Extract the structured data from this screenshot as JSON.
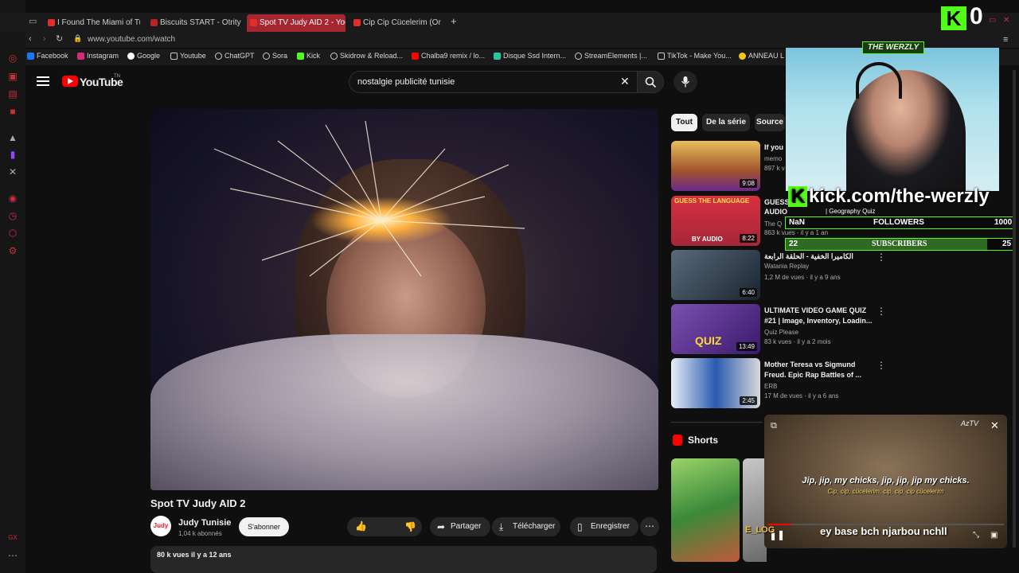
{
  "browser": {
    "tabs": [
      {
        "label": "I Found The Miami of Tun",
        "active": false
      },
      {
        "label": "Biscuits START - Otrity",
        "active": false
      },
      {
        "label": "Spot TV Judy AID 2 - You",
        "active": true
      },
      {
        "label": "Cip Cip Cücelerim (Or",
        "active": false
      }
    ],
    "new_tab": "+",
    "url": "www.youtube.com/watch",
    "bookmarks": [
      {
        "label": "Facebook",
        "color": "#1877f2"
      },
      {
        "label": "Instagram",
        "color": "#d62976"
      },
      {
        "label": "Google",
        "color": "#ffffff"
      },
      {
        "label": "Youtube",
        "color": "#cccccc"
      },
      {
        "label": "ChatGPT",
        "color": "#cccccc"
      },
      {
        "label": "Sora",
        "color": "#cccccc"
      },
      {
        "label": "Kick",
        "color": "#53fc18"
      },
      {
        "label": "Skidrow & Reload...",
        "color": "#cccccc"
      },
      {
        "label": "Chalba9 remix / lo...",
        "color": "#ff0000"
      },
      {
        "label": "Disque Ssd Intern...",
        "color": "#28c7a0"
      },
      {
        "label": "StreamElements |...",
        "color": "#cccccc"
      },
      {
        "label": "TikTok - Make You...",
        "color": "#cccccc"
      },
      {
        "label": "ANNEAU L",
        "color": "#f5c518"
      }
    ]
  },
  "youtube": {
    "logo": "YouTube",
    "region": "TN",
    "search_value": "nostalgie publicité tunisie",
    "video": {
      "title": "Spot TV Judy AID 2",
      "channel": "Judy Tunisie",
      "channel_avatar": "Judy",
      "subscribers": "1,04 k abonnés",
      "subscribe_label": "S'abonner",
      "share_label": "Partager",
      "download_label": "Télécharger",
      "save_label": "Enregistrer",
      "views_date": "80 k vues  il y a 12 ans"
    },
    "chips": [
      "Tout",
      "De la série",
      "Source"
    ],
    "recommendations": [
      {
        "title": "If you",
        "channel": "memo",
        "meta": "897 k v",
        "duration": "9:08",
        "thumb": "#c59a35"
      },
      {
        "title": "GUESS",
        "channel": "The Q",
        "meta": "863 k vues · il y a 1 an",
        "duration": "8:22",
        "thumb": "#b83040",
        "thumb_text_top": "GUESS THE LANGUAGE",
        "thumb_text_bottom": "BY AUDIO",
        "title2": "AUDIO"
      },
      {
        "title": "الكاميرا الخفية - الحلقة الرابعة",
        "channel": "Watania Replay",
        "meta": "1,2 M de vues · il y a 9 ans",
        "duration": "6:40",
        "thumb": "#3a4a5a"
      },
      {
        "title": "ULTIMATE VIDEO GAME QUIZ #21 | Image, Inventory, Loadin...",
        "channel": "Quiz Please",
        "meta": "83 k vues · il y a 2 mois",
        "duration": "13:49",
        "thumb": "#6a3fa0",
        "thumb_text_bottom": "QUIZ"
      },
      {
        "title": "Mother Teresa vs Sigmund Freud. Epic Rap Battles of ...",
        "channel": "ERB",
        "meta": "17 M de vues · il y a 6 ans",
        "duration": "2:45",
        "thumb": "#2a5ab0"
      }
    ],
    "shorts_label": "Shorts"
  },
  "overlay": {
    "kick_count": "0",
    "banner": "THE WERZLY",
    "kick_url": "kick.com/the-werzly",
    "geo_quiz": "| Geography Quiz",
    "followers": {
      "current": "NaN",
      "label": "FOLLOWERS",
      "goal": "1000",
      "progress": 0.0
    },
    "subscribers": {
      "current": "22",
      "label": "SUBSCRIBERS",
      "goal": "25",
      "progress": 0.88
    },
    "chat_prefix": "E_LOG",
    "chat_message": "ey base bch njarbou nchll"
  },
  "miniplayer": {
    "subtitle_en": "Jip, jip, my chicks, jip, jip, jip my chicks.",
    "subtitle_tr": "Cip, cip, cücelerim, cip, cip, cip cücelerim",
    "badge": "AzTV"
  }
}
